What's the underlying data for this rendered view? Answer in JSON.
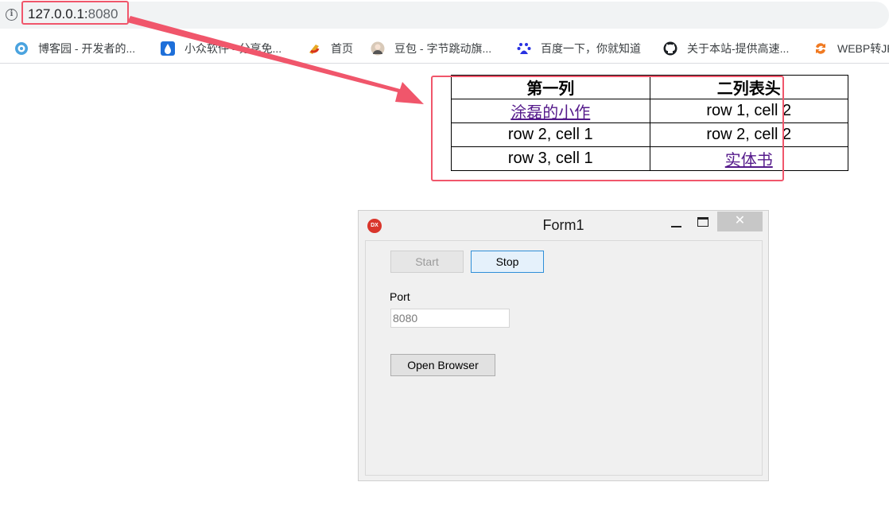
{
  "browser": {
    "url_host": "127.0.0.1:",
    "url_port": "8080",
    "bookmarks": [
      {
        "label": "博客园 - 开发者的...",
        "icon": "cnblogs-icon"
      },
      {
        "label": "小众软件 - 分享免...",
        "icon": "waterdrop-icon"
      },
      {
        "label": "首页",
        "icon": "flag-icon"
      },
      {
        "label": "豆包 - 字节跳动旗...",
        "icon": "avatar-icon"
      },
      {
        "label": "百度一下，你就知道",
        "icon": "baidu-icon"
      },
      {
        "label": "关于本站-提供高速...",
        "icon": "github-icon"
      },
      {
        "label": "WEBP转JP",
        "icon": "convert-icon"
      }
    ]
  },
  "table": {
    "headers": [
      "第一列",
      "二列表头"
    ],
    "rows": [
      [
        "涂磊的小作",
        "row 1, cell 2"
      ],
      [
        "row 2, cell 1",
        "row 2, cell 2"
      ],
      [
        "row 3, cell 1",
        "实体书"
      ]
    ]
  },
  "form": {
    "title": "Form1",
    "icon_text": "DX",
    "close_glyph": "✕",
    "start_label": "Start",
    "stop_label": "Stop",
    "port_label": "Port",
    "port_value": "8080",
    "open_browser_label": "Open Browser"
  },
  "colors": {
    "highlight": "#f0566b",
    "link": "#551a8b"
  }
}
